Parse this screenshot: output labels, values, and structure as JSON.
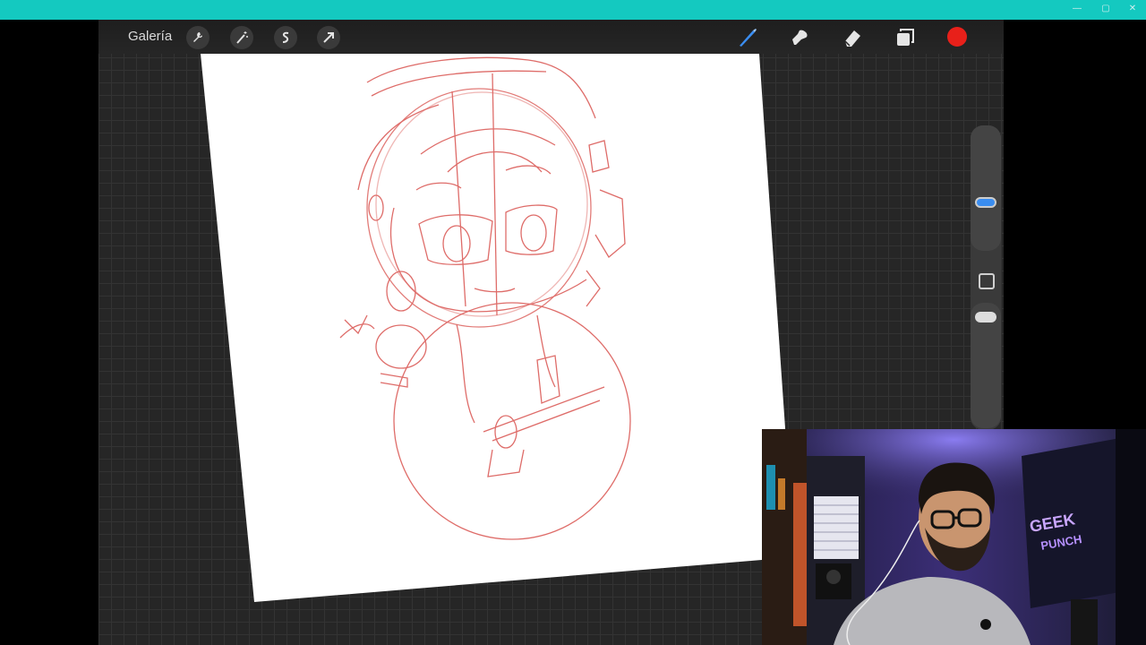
{
  "window": {
    "accent": "#14c9c0"
  },
  "toolbar": {
    "gallery_label": "Galería",
    "left_icons": [
      "wrench-icon",
      "magic-wand-icon",
      "selection-icon",
      "transform-arrow-icon"
    ],
    "right_icons": [
      "brush-icon",
      "smudge-icon",
      "eraser-icon",
      "layers-icon"
    ],
    "current_color": "#e8201a"
  },
  "sidebar": {
    "brush_size_level": 0.3,
    "opacity_level": 0.0,
    "handle_active_color": "#3a8df0"
  },
  "canvas": {
    "background": "#ffffff",
    "sketch_color": "#d9534f",
    "sketch_subject": "chibi-character"
  },
  "webcam": {
    "neon_sign_text": "GEEK PUNCH"
  }
}
